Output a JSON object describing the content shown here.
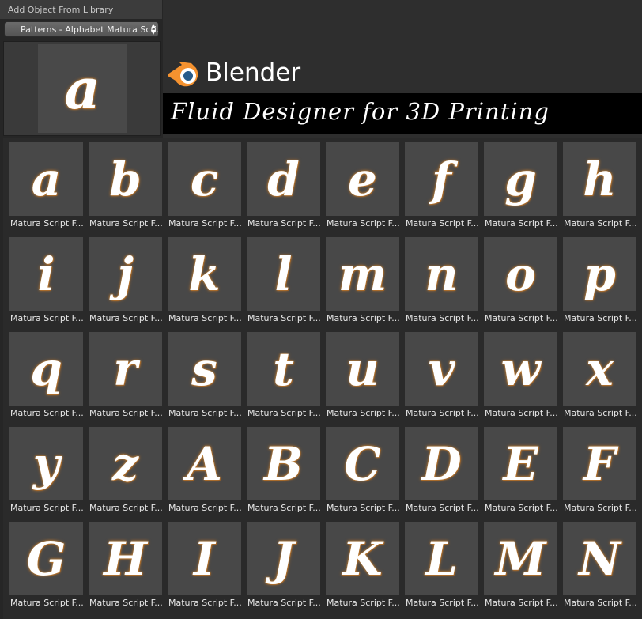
{
  "panel": {
    "title": "Add Object From Library",
    "dropdown_value": "Patterns - Alphabet Matura Scri...",
    "preview_glyph": "a"
  },
  "banner": {
    "logo_text": "Blender",
    "title": "Fluid Designer for 3D Printing"
  },
  "tiles": [
    {
      "glyph": "a",
      "label": "Matura Script F..."
    },
    {
      "glyph": "b",
      "label": "Matura Script F..."
    },
    {
      "glyph": "c",
      "label": "Matura Script F..."
    },
    {
      "glyph": "d",
      "label": "Matura Script F..."
    },
    {
      "glyph": "e",
      "label": "Matura Script F..."
    },
    {
      "glyph": "f",
      "label": "Matura Script F..."
    },
    {
      "glyph": "g",
      "label": "Matura Script F..."
    },
    {
      "glyph": "h",
      "label": "Matura Script F..."
    },
    {
      "glyph": "i",
      "label": "Matura Script F..."
    },
    {
      "glyph": "j",
      "label": "Matura Script F..."
    },
    {
      "glyph": "k",
      "label": "Matura Script F..."
    },
    {
      "glyph": "l",
      "label": "Matura Script F..."
    },
    {
      "glyph": "m",
      "label": "Matura Script F..."
    },
    {
      "glyph": "n",
      "label": "Matura Script F..."
    },
    {
      "glyph": "o",
      "label": "Matura Script F..."
    },
    {
      "glyph": "p",
      "label": "Matura Script F..."
    },
    {
      "glyph": "q",
      "label": "Matura Script F..."
    },
    {
      "glyph": "r",
      "label": "Matura Script F..."
    },
    {
      "glyph": "s",
      "label": "Matura Script F..."
    },
    {
      "glyph": "t",
      "label": "Matura Script F..."
    },
    {
      "glyph": "u",
      "label": "Matura Script F..."
    },
    {
      "glyph": "v",
      "label": "Matura Script F..."
    },
    {
      "glyph": "w",
      "label": "Matura Script F..."
    },
    {
      "glyph": "x",
      "label": "Matura Script F..."
    },
    {
      "glyph": "y",
      "label": "Matura Script F..."
    },
    {
      "glyph": "z",
      "label": "Matura Script F..."
    },
    {
      "glyph": "A",
      "label": "Matura Script F..."
    },
    {
      "glyph": "B",
      "label": "Matura Script F..."
    },
    {
      "glyph": "C",
      "label": "Matura Script F..."
    },
    {
      "glyph": "D",
      "label": "Matura Script F..."
    },
    {
      "glyph": "E",
      "label": "Matura Script F..."
    },
    {
      "glyph": "F",
      "label": "Matura Script F..."
    },
    {
      "glyph": "G",
      "label": "Matura Script F..."
    },
    {
      "glyph": "H",
      "label": "Matura Script F..."
    },
    {
      "glyph": "I",
      "label": "Matura Script F..."
    },
    {
      "glyph": "J",
      "label": "Matura Script F..."
    },
    {
      "glyph": "K",
      "label": "Matura Script F..."
    },
    {
      "glyph": "L",
      "label": "Matura Script F..."
    },
    {
      "glyph": "M",
      "label": "Matura Script F..."
    },
    {
      "glyph": "N",
      "label": "Matura Script F..."
    }
  ],
  "colors": {
    "accent_orange": "#f5922f",
    "logo_blue": "#275b8a"
  }
}
